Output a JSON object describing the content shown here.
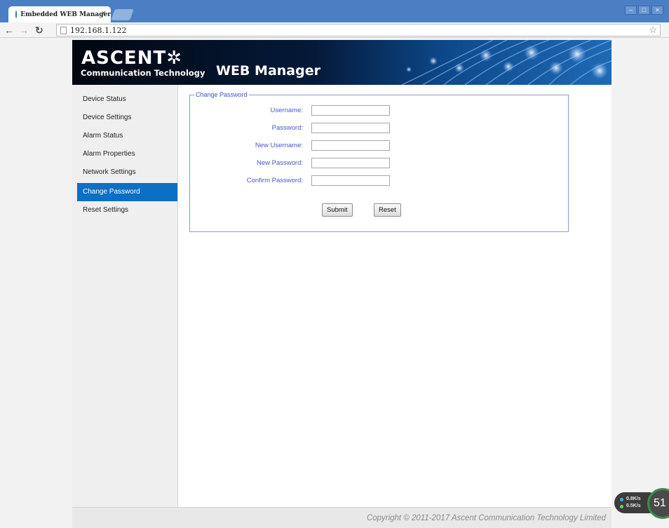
{
  "browser": {
    "tab_title": "Embedded WEB Manager",
    "tab_close": "×",
    "url": "192.168.1.122",
    "window_controls": [
      "–",
      "□",
      "×"
    ]
  },
  "header": {
    "logo_main": "ASCENT",
    "logo_symbol": "✲",
    "logo_sub": "Communication Technology",
    "title": "WEB Manager"
  },
  "sidebar": {
    "items": [
      {
        "label": "Device Status"
      },
      {
        "label": "Device Settings"
      },
      {
        "label": "Alarm Status"
      },
      {
        "label": "Alarm Properties"
      },
      {
        "label": "Network Settings"
      },
      {
        "label": "Change Password",
        "active": true
      },
      {
        "label": "Reset Settings"
      }
    ]
  },
  "form": {
    "legend": "Change Password",
    "fields": [
      {
        "label": "Username:",
        "value": ""
      },
      {
        "label": "Password:",
        "value": ""
      },
      {
        "label": "New Username:",
        "value": ""
      },
      {
        "label": "New Password:",
        "value": ""
      },
      {
        "label": "Confirm Password:",
        "value": ""
      }
    ],
    "submit_label": "Submit",
    "reset_label": "Reset"
  },
  "footer": {
    "copyright": "Copyright © 2011-2017 Ascent Communication Technology Limited"
  },
  "speed_widget": {
    "upload": "0.8K/s",
    "download": "0.5K/s",
    "percent": "51"
  },
  "colors": {
    "accent": "#0b6fc6",
    "label_blue": "#4a56c8",
    "titlebar": "#4a7fc4"
  }
}
